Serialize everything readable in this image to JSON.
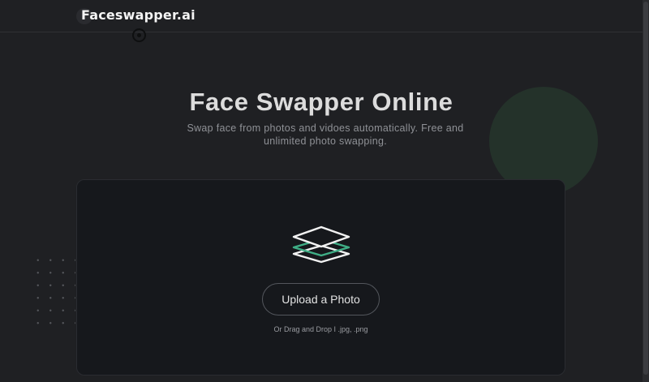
{
  "header": {
    "logo_text": "Faceswapper.ai"
  },
  "hero": {
    "title": "Face Swapper Online",
    "subtitle": "Swap face from photos and vidoes automatically. Free and unlimited photo swapping."
  },
  "upload": {
    "icon": "layers-icon",
    "button_label": "Upload a Photo",
    "hint": "Or Drag and Drop I .jpg, .png"
  },
  "colors": {
    "background": "#1f2023",
    "card": "#16181c",
    "accent": "#3fae86",
    "deco_circle": "#24322a"
  }
}
